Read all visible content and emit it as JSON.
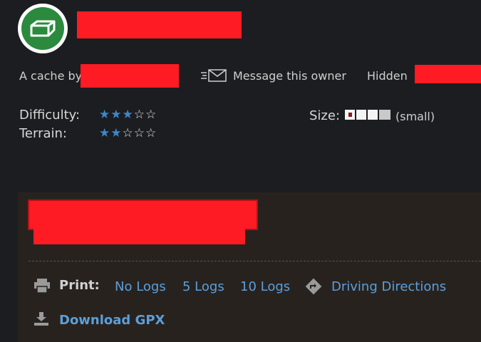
{
  "header": {
    "icon": "traditional-cache-icon"
  },
  "meta": {
    "by_prefix": "A cache by",
    "message_label": "Message this owner",
    "message_icon": "envelope-icon",
    "hidden_prefix": "Hidden"
  },
  "ratings": {
    "difficulty_label": "Difficulty:",
    "difficulty_value": 3,
    "terrain_label": "Terrain:",
    "terrain_value": 2,
    "max": 5,
    "size_label": "Size:",
    "size_value": "(small)"
  },
  "actions": {
    "print_label": "Print:",
    "print_icon": "printer-icon",
    "no_logs": "No Logs",
    "five_logs": "5 Logs",
    "ten_logs": "10 Logs",
    "directions_icon": "directions-icon",
    "directions_label": "Driving Directions",
    "download_icon": "download-icon",
    "download_label": "Download GPX"
  },
  "colors": {
    "background": "#1c1d20",
    "panel": "#28221e",
    "accent": "#5b9fdc",
    "star_full": "#3e86c9",
    "redaction": "#fe1b23",
    "cache_icon": "#2b8a3e"
  }
}
